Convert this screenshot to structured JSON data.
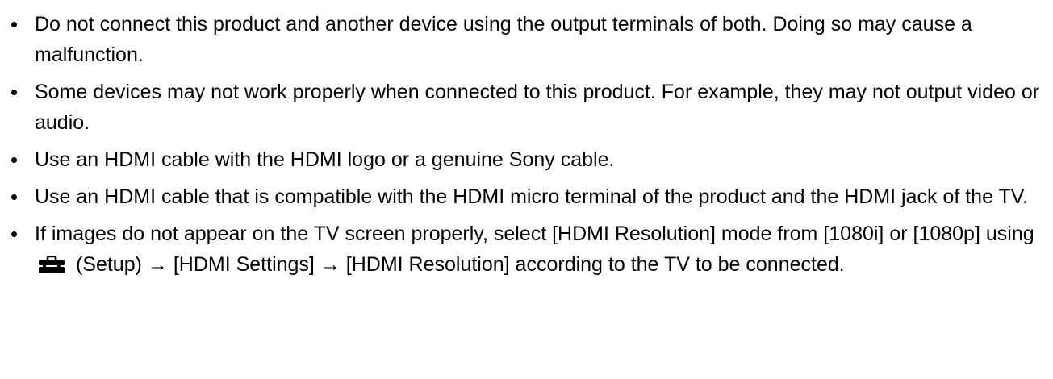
{
  "notes": [
    "Do not connect this product and another device using the output terminals of both. Doing so may cause a malfunction.",
    "Some devices may not work properly when connected to this product. For example, they may not output video or audio.",
    "Use an HDMI cable with the HDMI logo or a genuine Sony cable.",
    "Use an HDMI cable that is compatible with the HDMI micro terminal of the product and the HDMI jack of the TV."
  ],
  "last_note": {
    "before_icon": "If images do not appear on the TV screen properly, select [HDMI Resolution] mode from [1080i] or [1080p] using",
    "icon": "toolbox-setup-icon",
    "after_icon": "(Setup) → [HDMI Settings] → [HDMI Resolution] according to the TV to be connected."
  }
}
